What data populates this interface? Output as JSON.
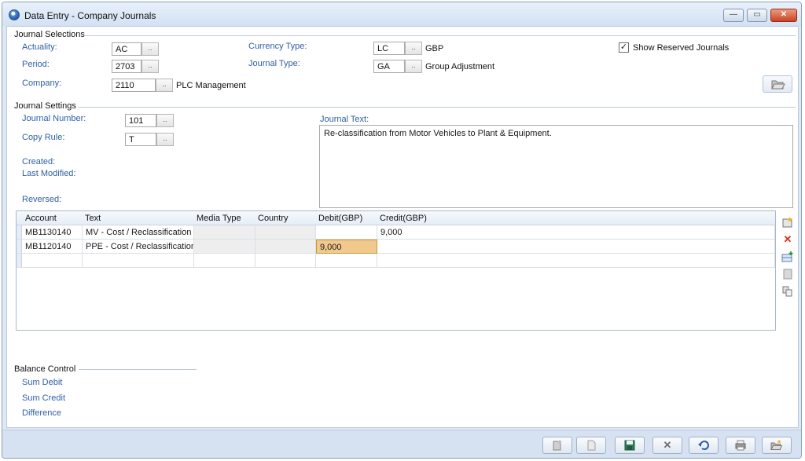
{
  "window": {
    "title": "Data Entry - Company Journals",
    "buttons": {
      "minimize": "—",
      "maximize": "▭",
      "close": "✕"
    }
  },
  "journal_selections": {
    "title": "Journal Selections",
    "actuality": {
      "label": "Actuality:",
      "value": "AC"
    },
    "period": {
      "label": "Period:",
      "value": "2703"
    },
    "company": {
      "label": "Company:",
      "value": "2110",
      "description": "PLC Management"
    },
    "currency_type": {
      "label": "Currency Type:",
      "value": "LC",
      "description": "GBP"
    },
    "journal_type": {
      "label": "Journal Type:",
      "value": "GA",
      "description": "Group Adjustment"
    },
    "show_reserved": {
      "label": "Show Reserved Journals",
      "checked": true
    },
    "ellipsis": ".."
  },
  "journal_settings": {
    "title": "Journal Settings",
    "journal_number": {
      "label": "Journal Number:",
      "value": "101"
    },
    "copy_rule": {
      "label": "Copy Rule:",
      "value": "T"
    },
    "created_label": "Created:",
    "last_modified_label": "Last Modified:",
    "reversed_label": "Reversed:",
    "journal_text": {
      "label": "Journal Text:",
      "value": "Re-classification from Motor Vehicles to Plant & Equipment."
    }
  },
  "grid": {
    "columns": [
      "Account",
      "Text",
      "Media Type",
      "Country",
      "Debit(GBP)",
      "Credit(GBP)"
    ],
    "rows": [
      {
        "account": "MB1130140",
        "text": "MV - Cost / Reclassification",
        "media_type": "",
        "country": "",
        "debit": "",
        "credit": "9,000"
      },
      {
        "account": "MB1120140",
        "text": "PPE - Cost / Reclassification",
        "media_type": "",
        "country": "",
        "debit": "9,000",
        "credit": ""
      },
      {
        "account": "",
        "text": "",
        "media_type": "",
        "country": "",
        "debit": "",
        "credit": ""
      }
    ]
  },
  "balance_control": {
    "title": "Balance Control",
    "sum_debit": "Sum Debit",
    "sum_credit": "Sum Credit",
    "difference": "Difference"
  },
  "icons": {
    "open_folder": "folder-open-icon",
    "side": [
      "new-row-icon",
      "delete-row-icon",
      "insert-row-icon",
      "grid-icon",
      "copy-icon"
    ],
    "footer": [
      "new-icon",
      "blank-page-icon",
      "save-icon",
      "delete-icon",
      "undo-icon",
      "print-icon",
      "open-icon"
    ]
  },
  "colors": {
    "label_blue": "#2f5fa5",
    "selected_cell": "#f2c98c",
    "delete_red": "#d6301b"
  }
}
